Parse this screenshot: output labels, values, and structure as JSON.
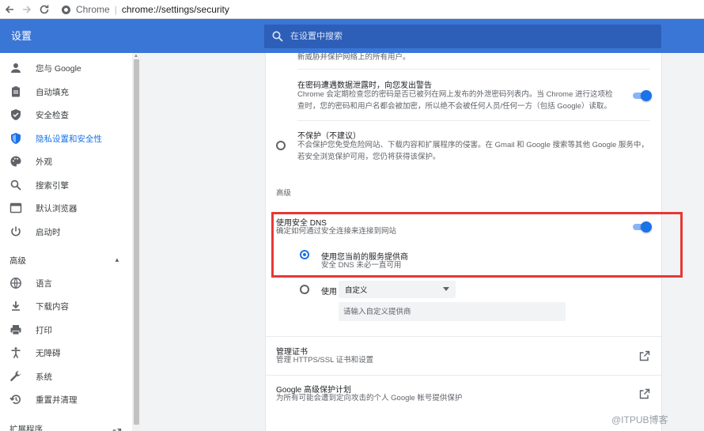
{
  "browser": {
    "site_name": "Chrome",
    "url": "chrome://settings/security"
  },
  "header": {
    "title": "设置",
    "search_placeholder": "在设置中搜索"
  },
  "sidebar": {
    "items": [
      {
        "label": "您与 Google",
        "icon": "person-icon"
      },
      {
        "label": "自动填充",
        "icon": "clipboard-icon"
      },
      {
        "label": "安全检查",
        "icon": "shield-check-icon"
      },
      {
        "label": "隐私设置和安全性",
        "icon": "shield-icon",
        "active": true
      },
      {
        "label": "外观",
        "icon": "palette-icon"
      },
      {
        "label": "搜索引擎",
        "icon": "search-icon"
      },
      {
        "label": "默认浏览器",
        "icon": "browser-icon"
      },
      {
        "label": "启动时",
        "icon": "power-icon"
      }
    ],
    "advanced_label": "高级",
    "advanced_items": [
      {
        "label": "语言",
        "icon": "globe-icon"
      },
      {
        "label": "下载内容",
        "icon": "download-icon"
      },
      {
        "label": "打印",
        "icon": "printer-icon"
      },
      {
        "label": "无障碍",
        "icon": "accessibility-icon"
      },
      {
        "label": "系统",
        "icon": "wrench-icon"
      },
      {
        "label": "重置并清理",
        "icon": "restore-icon"
      }
    ],
    "cut_item": {
      "label": "扩展程序"
    }
  },
  "main": {
    "top_text": "新威胁并保护网络上的所有用户。",
    "breach": {
      "title": "在密码遭遇数据泄露时，向您发出警告",
      "desc_line1": "Chrome 会定期检查您的密码是否已被列在网上发布的外泄密码列表内。当 Chrome 进行这项检",
      "desc_line2": "查时，您的密码和用户名都会被加密，所以绝不会被任何人员/任何一方（包括 Google）读取。",
      "enabled": true
    },
    "no_protection": {
      "title": "不保护（不建议）",
      "desc_line1": "不会保护您免受危险网站、下载内容和扩展程序的侵害。在 Gmail 和 Google 搜索等其他 Google 服务中，",
      "desc_line2": "若安全浏览保护可用，您仍将获得该保护。",
      "selected": false
    },
    "advanced_heading": "高级",
    "secure_dns": {
      "title": "使用安全 DNS",
      "desc": "确定如何通过安全连接来连接到网站",
      "enabled": true,
      "option_current": {
        "title": "使用您当前的服务提供商",
        "desc": "安全 DNS 未必一直可用",
        "selected": true
      },
      "option_custom": {
        "label": "使用",
        "select_value": "自定义",
        "input_placeholder": "请输入自定义提供商",
        "selected": false
      }
    },
    "certificates": {
      "title": "管理证书",
      "desc": "管理 HTTPS/SSL 证书和设置"
    },
    "advanced_protection": {
      "title": "Google 高级保护计划",
      "desc": "为所有可能会遭到定向攻击的个人 Google 帐号提供保护"
    }
  },
  "watermark": "@ITPUB博客",
  "colors": {
    "header_blue": "#3a76d6",
    "accent": "#1a73e8",
    "highlight_red": "#e53935"
  }
}
